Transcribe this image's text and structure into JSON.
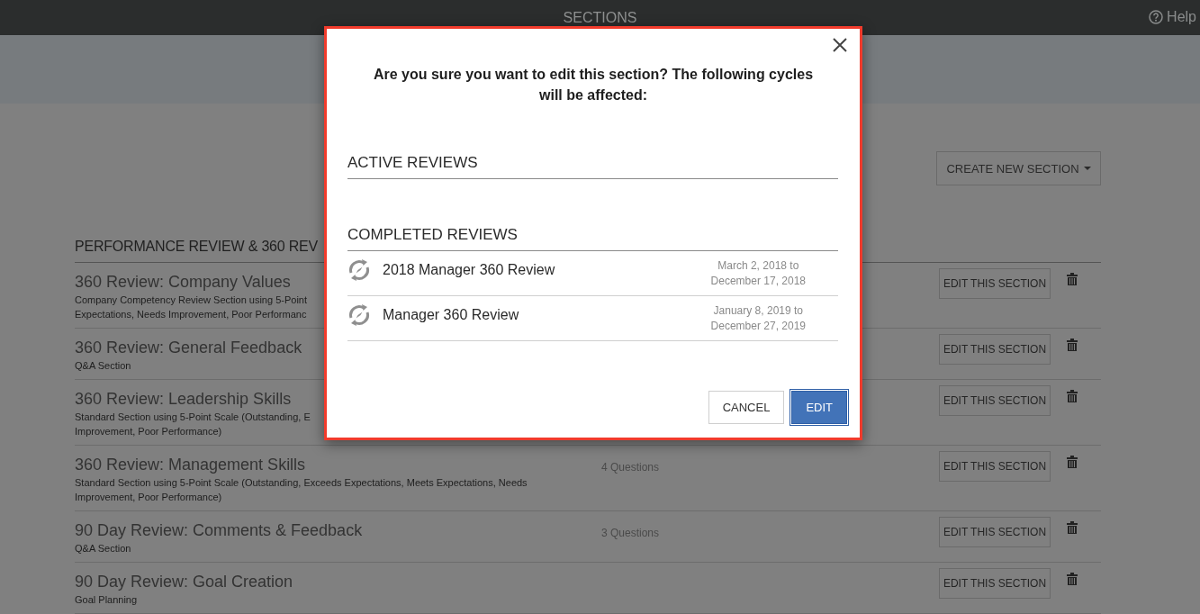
{
  "topbar": {
    "title": "SECTIONS",
    "help": "Help"
  },
  "create_button": {
    "label": "CREATE NEW SECTION"
  },
  "group": {
    "title": "PERFORMANCE REVIEW & 360 REV",
    "sections": [
      {
        "title": "360 Review: Company Values",
        "description_lines": [
          "Company Competency Review Section using 5-Point",
          "Expectations, Needs Improvement, Poor Performanc"
        ],
        "edit_button": "EDIT THIS SECTION"
      },
      {
        "title": "360 Review: General Feedback",
        "description_lines": [
          "Q&A Section"
        ],
        "edit_button": "EDIT THIS SECTION"
      },
      {
        "title": "360 Review: Leadership Skills",
        "description_lines": [
          "Standard Section using 5-Point Scale (Outstanding, E",
          "Improvement, Poor Performance)"
        ],
        "edit_button": "EDIT THIS SECTION"
      },
      {
        "title": "360 Review: Management Skills",
        "description_lines": [
          "Standard Section using 5-Point Scale (Outstanding, Exceeds Expectations, Meets Expectations, Needs",
          "Improvement, Poor Performance)"
        ],
        "questions": "4 Questions",
        "edit_button": "EDIT THIS SECTION"
      },
      {
        "title": "90 Day Review: Comments & Feedback",
        "description_lines": [
          "Q&A Section"
        ],
        "questions": "3 Questions",
        "edit_button": "EDIT THIS SECTION"
      },
      {
        "title": "90 Day Review: Goal Creation",
        "description_lines": [
          "Goal Planning"
        ],
        "edit_button": "EDIT THIS SECTION"
      }
    ]
  },
  "dialog": {
    "message": "Are you sure you want to edit this section? The following cycles will be affected:",
    "groups": [
      {
        "title": "ACTIVE REVIEWS"
      },
      {
        "title": "COMPLETED REVIEWS",
        "cycles": [
          {
            "name": "2018 Manager 360 Review",
            "dates": [
              "March 2, 2018 to",
              "December 17, 2018"
            ]
          },
          {
            "name": "Manager 360 Review",
            "dates": [
              "January 8, 2019 to",
              "December 27, 2019"
            ]
          }
        ]
      }
    ],
    "buttons": [
      {
        "label": "CANCEL",
        "kind": "secondary"
      },
      {
        "label": "EDIT",
        "kind": "primary"
      }
    ]
  }
}
